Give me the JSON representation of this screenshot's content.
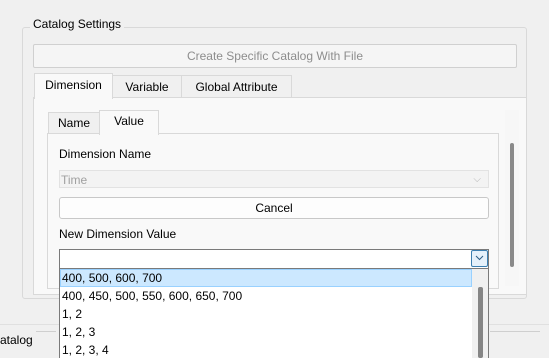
{
  "catalog_settings": {
    "title": "Catalog Settings",
    "create_button": "Create Specific Catalog With File"
  },
  "outer_tabs": [
    {
      "label": "Dimension",
      "active": true
    },
    {
      "label": "Variable",
      "active": false
    },
    {
      "label": "Global Attribute",
      "active": false
    }
  ],
  "inner_tabs": [
    {
      "label": "Name",
      "active": false
    },
    {
      "label": "Value",
      "active": true
    }
  ],
  "dimension_name": {
    "label": "Dimension Name",
    "value": "Time"
  },
  "cancel_button": "Cancel",
  "new_dimension_value": {
    "label": "New Dimension Value",
    "value": "",
    "options": [
      "400, 500, 600, 700",
      "400, 450, 500, 550, 600, 650, 700",
      "1, 2",
      "1, 2, 3",
      "1, 2, 3, 4"
    ],
    "selected_index": 0
  },
  "bottom_panel": {
    "label": "atalog"
  },
  "icons": {
    "chevron": "chevron-down-icon"
  },
  "colors": {
    "selected_bg": "#cce8ff",
    "accent": "#3c7fb1"
  }
}
